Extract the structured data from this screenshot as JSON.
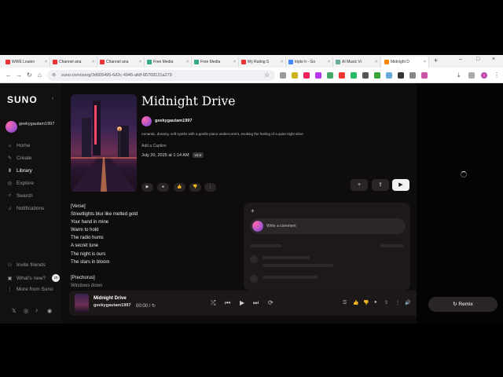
{
  "browser": {
    "tabs": [
      {
        "label": "WWE Leanin",
        "color": "#e33"
      },
      {
        "label": "Channel ana",
        "color": "#e33"
      },
      {
        "label": "Channel ana",
        "color": "#e33"
      },
      {
        "label": "Free Media",
        "color": "#3a8"
      },
      {
        "label": "Free Media",
        "color": "#3a8"
      },
      {
        "label": "My Rating S",
        "color": "#e33"
      },
      {
        "label": "triple h - Go",
        "color": "#48f"
      },
      {
        "label": "AI Music Vi",
        "color": "#6a9"
      },
      {
        "label": "Midnight D",
        "color": "#f80"
      }
    ],
    "close_glyph": "×",
    "new_tab": "+",
    "window_controls": [
      "–",
      "□",
      "×"
    ],
    "url": "suno.com/song/3d005495-6d2c-4945-afdf-85768121a279",
    "nav": {
      "back": "←",
      "forward": "→",
      "reload": "↻",
      "home": "⌂",
      "info": "⊚",
      "star": "☆",
      "download": "⤓",
      "menu": "⋮"
    }
  },
  "sidebar": {
    "logo": "SUNO",
    "collapse": "‹",
    "user": "geekygautam1997",
    "items": [
      {
        "label": "Home",
        "icon": "⌂"
      },
      {
        "label": "Create",
        "icon": "✎"
      },
      {
        "label": "Library",
        "icon": "Ⅱ"
      },
      {
        "label": "Explore",
        "icon": "◎"
      },
      {
        "label": "Search",
        "icon": "⌕"
      },
      {
        "label": "Notifications",
        "icon": "♫"
      }
    ],
    "bottom": [
      {
        "label": "Invite friends",
        "icon": "⚇"
      },
      {
        "label": "What's new?",
        "icon": "▣",
        "badge": "20"
      },
      {
        "label": "More from Suno",
        "icon": "⋮"
      }
    ],
    "social": [
      "𝕏",
      "◎",
      "♪",
      "◉"
    ]
  },
  "song": {
    "title": "Midnight Drive",
    "artist": "geekygautam1997",
    "description": "romantic, dreamy, soft synths with a gentle piano undercurrent, evoking the feeling of a quiet night drive",
    "add_caption": "Add a Caption",
    "date": "July 20, 2025 at 1:14 AM",
    "version": "v3.5",
    "actions": {
      "play": "▶",
      "comment": "●",
      "like": "👍",
      "dislike": "👎",
      "more": "⋮"
    },
    "buttons": {
      "add": "+",
      "share": "⇪",
      "play": "▶"
    }
  },
  "lyrics": [
    "[Verse]",
    "Streetlights blur like melted gold",
    "Your hand in mine",
    "Warm to hold",
    "The radio hums",
    "A secret tune",
    "The night is ours",
    "The stars in bloom",
    "",
    "[Prechorus]",
    "Windows down"
  ],
  "comments": {
    "add": "+",
    "placeholder": "Write a comment"
  },
  "player": {
    "title": "Midnight Drive",
    "artist": "geekygautam1997",
    "time": "00:00 /",
    "controls": {
      "shuffle": "⤮",
      "prev": "⏮",
      "play": "▶",
      "next": "⏭",
      "repeat": "⟳"
    },
    "right_controls": [
      "☰",
      "👍",
      "👎",
      "●",
      "⇪",
      "⋮",
      "🔊"
    ]
  },
  "right_panel": {
    "remix_label": "Remix",
    "remix_icon": "↻"
  }
}
